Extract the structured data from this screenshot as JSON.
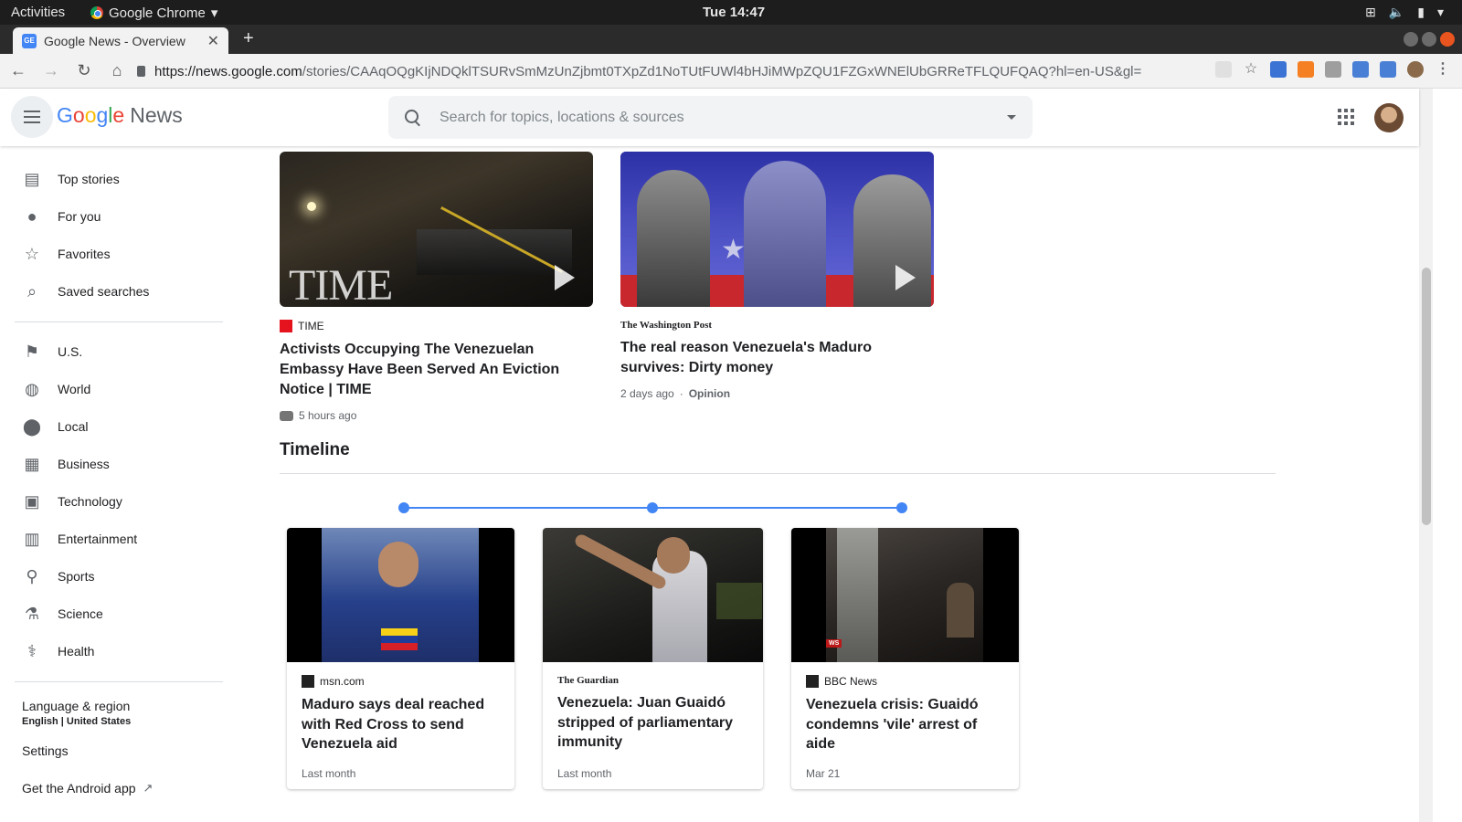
{
  "os": {
    "activities": "Activities",
    "app_name": "Google Chrome",
    "clock": "Tue 14:47"
  },
  "browser": {
    "tab_title": "Google News - Overview",
    "favicon_text": "GE",
    "url_host": "https://news.google.com",
    "url_rest": "/stories/CAAqOQgKIjNDQklTSURvSmMzUnZjbmt0TXpZd1NoTUtFUWl4bHJiMWpZQU1FZGxWNElUbGRReTFLQUFQAQ?hl=en-US&gl=US&ceid=US..."
  },
  "header": {
    "logo_google": [
      "G",
      "o",
      "o",
      "g",
      "l",
      "e"
    ],
    "logo_news": "News",
    "search_placeholder": "Search for topics, locations & sources"
  },
  "sidebar": {
    "primary": [
      {
        "label": "Top stories",
        "icon": "top-stories-icon"
      },
      {
        "label": "For you",
        "icon": "person-icon"
      },
      {
        "label": "Favorites",
        "icon": "star-icon"
      },
      {
        "label": "Saved searches",
        "icon": "search-icon"
      }
    ],
    "sections": [
      {
        "label": "U.S.",
        "icon": "flag-icon"
      },
      {
        "label": "World",
        "icon": "globe-icon"
      },
      {
        "label": "Local",
        "icon": "location-pin-icon"
      },
      {
        "label": "Business",
        "icon": "building-icon"
      },
      {
        "label": "Technology",
        "icon": "chip-icon"
      },
      {
        "label": "Entertainment",
        "icon": "film-icon"
      },
      {
        "label": "Sports",
        "icon": "bicycle-icon"
      },
      {
        "label": "Science",
        "icon": "flask-icon"
      },
      {
        "label": "Health",
        "icon": "health-icon"
      }
    ],
    "language_label": "Language & region",
    "language_value": "English | United States",
    "settings": "Settings",
    "android_app": "Get the Android app"
  },
  "videos": [
    {
      "source": "TIME",
      "thumb_text": "TIME",
      "headline": "Activists Occupying The Venezuelan Embassy Have Been Served An Eviction Notice | TIME",
      "time": "5 hours ago"
    },
    {
      "source": "The Washington Post",
      "headline": "The real reason Venezuela's Maduro survives: Dirty money",
      "time": "2 days ago",
      "tag": "Opinion"
    }
  ],
  "timeline": {
    "title": "Timeline",
    "cards": [
      {
        "source": "msn.com",
        "headline": "Maduro says deal reached with Red Cross to send Venezuela aid",
        "date": "Last month"
      },
      {
        "source": "The Guardian",
        "headline": "Venezuela: Juan Guaidó stripped of parliamentary immunity",
        "date": "Last month"
      },
      {
        "source": "BBC News",
        "headline": "Venezuela crisis: Guaidó condemns 'vile' arrest of aide",
        "date": "Mar 21",
        "thumb_badge": "WS"
      }
    ]
  },
  "colors": {
    "accent": "#4285f4",
    "time_red": "#e5131d"
  }
}
